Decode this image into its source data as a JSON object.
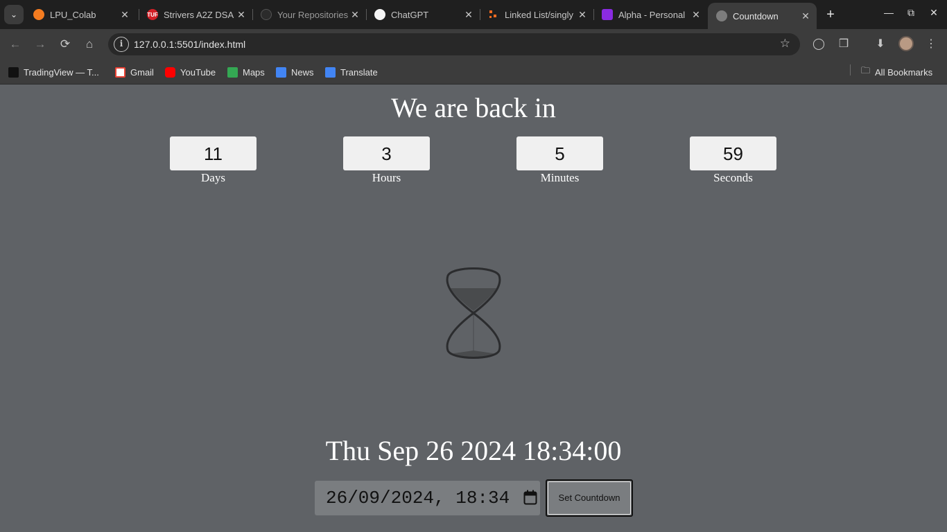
{
  "browser": {
    "tabs": [
      {
        "title": "LPU_Colab",
        "icon": "lpu-logo-icon"
      },
      {
        "title": "Strivers A2Z DSA",
        "icon": "tuf-logo-icon"
      },
      {
        "title": "Your Repositories",
        "icon": "github-logo-icon"
      },
      {
        "title": "ChatGPT",
        "icon": "openai-logo-icon"
      },
      {
        "title": "Linked List/singly",
        "icon": "linked-list-icon"
      },
      {
        "title": "Alpha - Personal",
        "icon": "alpha-logo-icon"
      },
      {
        "title": "Countdown",
        "icon": "globe-icon",
        "active": true
      }
    ],
    "favicon_letters": {
      "tuf": "TUF"
    },
    "url": "127.0.0.1:5501/index.html",
    "bookmarks": [
      {
        "label": "TradingView — T...",
        "icon": "tradingview-icon"
      },
      {
        "label": "Gmail",
        "icon": "gmail-icon"
      },
      {
        "label": "YouTube",
        "icon": "youtube-icon"
      },
      {
        "label": "Maps",
        "icon": "maps-icon"
      },
      {
        "label": "News",
        "icon": "news-icon"
      },
      {
        "label": "Translate",
        "icon": "translate-icon"
      }
    ],
    "all_bookmarks": "All Bookmarks",
    "colors": {
      "chrome_dark": "#1f1f1f",
      "chrome": "#3c3c3c",
      "page_bg": "#5f6266"
    }
  },
  "countdown": {
    "heading": "We are back in",
    "units": [
      {
        "value": "11",
        "label": "Days"
      },
      {
        "value": "3",
        "label": "Hours"
      },
      {
        "value": "5",
        "label": "Minutes"
      },
      {
        "value": "59",
        "label": "Seconds"
      }
    ],
    "target_text": "Thu Sep 26 2024 18:34:00",
    "input_value": "26/09/2024, 18:34",
    "button_label": "Set Countdown"
  }
}
